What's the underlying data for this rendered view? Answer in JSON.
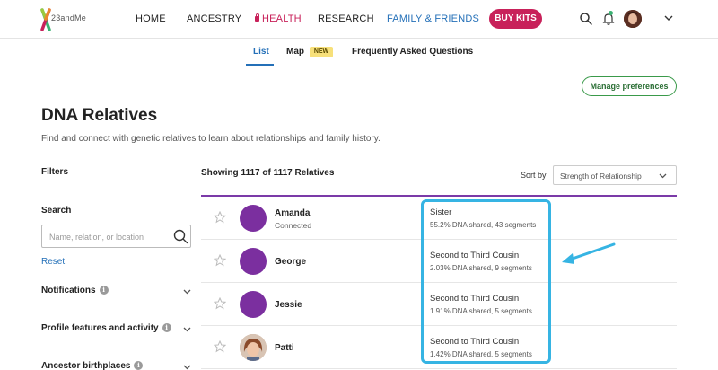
{
  "brand": {
    "name": "23andMe"
  },
  "nav": {
    "home": "HOME",
    "ancestry": "ANCESTRY",
    "health": "HEALTH",
    "research": "RESEARCH",
    "family": "FAMILY & FRIENDS",
    "buy_kits": "BUY KITS"
  },
  "subtabs": {
    "list": "List",
    "map": "Map",
    "map_badge": "NEW",
    "faq": "Frequently Asked Questions"
  },
  "manage_button": "Manage preferences",
  "page": {
    "title": "DNA Relatives",
    "subtitle": "Find and connect with genetic relatives to learn about relationships and family history."
  },
  "filters": {
    "title": "Filters",
    "search_label": "Search",
    "search_placeholder": "Name, relation, or location",
    "reset": "Reset",
    "sections": [
      "Notifications",
      "Profile features and activity",
      "Ancestor birthplaces"
    ]
  },
  "results": {
    "header": "Showing 1117 of 1117 Relatives",
    "sort_label": "Sort by",
    "sort_value": "Strength of Relationship",
    "rows": [
      {
        "name": "Amanda",
        "status": "Connected",
        "relationship": "Sister",
        "dna": "55.2% DNA shared, 43 segments"
      },
      {
        "name": "George",
        "status": "",
        "relationship": "Second to Third Cousin",
        "dna": "2.03% DNA shared, 9 segments"
      },
      {
        "name": "Jessie",
        "status": "",
        "relationship": "Second to Third Cousin",
        "dna": "1.91% DNA shared, 5 segments"
      },
      {
        "name": "Patti",
        "status": "",
        "relationship": "Second to Third Cousin",
        "dna": "1.42% DNA shared, 5 segments"
      }
    ]
  },
  "colors": {
    "accent_blue": "#2470b8",
    "health_pink": "#c8215a",
    "avatar_purple": "#7b2f9f",
    "divider_purple": "#7b3aa8",
    "highlight_cyan": "#36b4e3"
  }
}
